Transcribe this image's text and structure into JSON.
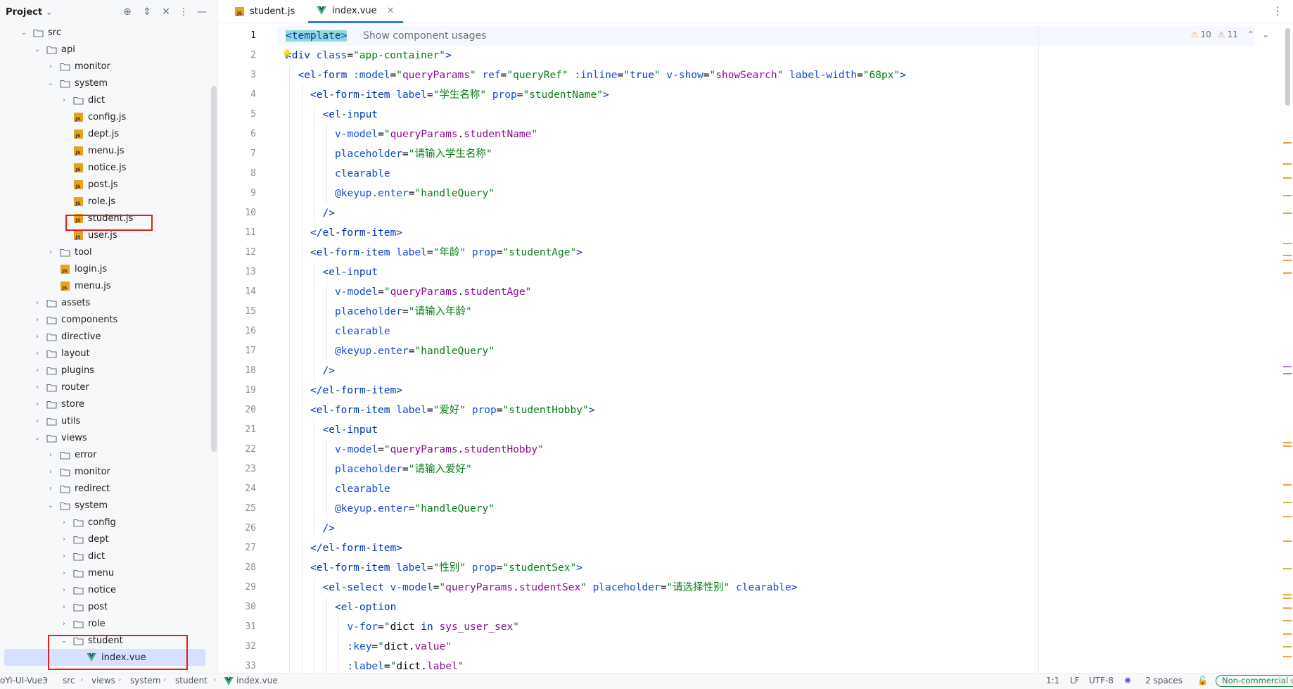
{
  "project_panel": {
    "title": "Project",
    "tree": [
      {
        "label": "src",
        "type": "folder",
        "depth": 0,
        "expanded": true
      },
      {
        "label": "api",
        "type": "folder",
        "depth": 1,
        "expanded": true
      },
      {
        "label": "monitor",
        "type": "folder",
        "depth": 2,
        "expanded": false
      },
      {
        "label": "system",
        "type": "folder",
        "depth": 2,
        "expanded": true
      },
      {
        "label": "dict",
        "type": "folder",
        "depth": 3,
        "expanded": false
      },
      {
        "label": "config.js",
        "type": "js",
        "depth": 3
      },
      {
        "label": "dept.js",
        "type": "js",
        "depth": 3
      },
      {
        "label": "menu.js",
        "type": "js",
        "depth": 3
      },
      {
        "label": "notice.js",
        "type": "js",
        "depth": 3
      },
      {
        "label": "post.js",
        "type": "js",
        "depth": 3
      },
      {
        "label": "role.js",
        "type": "js",
        "depth": 3
      },
      {
        "label": "student.js",
        "type": "js",
        "depth": 3
      },
      {
        "label": "user.js",
        "type": "js",
        "depth": 3
      },
      {
        "label": "tool",
        "type": "folder",
        "depth": 2,
        "expanded": false
      },
      {
        "label": "login.js",
        "type": "js",
        "depth": 2
      },
      {
        "label": "menu.js",
        "type": "js",
        "depth": 2
      },
      {
        "label": "assets",
        "type": "folder",
        "depth": 1,
        "expanded": false
      },
      {
        "label": "components",
        "type": "folder",
        "depth": 1,
        "expanded": false
      },
      {
        "label": "directive",
        "type": "folder",
        "depth": 1,
        "expanded": false
      },
      {
        "label": "layout",
        "type": "folder",
        "depth": 1,
        "expanded": false
      },
      {
        "label": "plugins",
        "type": "folder",
        "depth": 1,
        "expanded": false
      },
      {
        "label": "router",
        "type": "folder",
        "depth": 1,
        "expanded": false
      },
      {
        "label": "store",
        "type": "folder",
        "depth": 1,
        "expanded": false
      },
      {
        "label": "utils",
        "type": "folder",
        "depth": 1,
        "expanded": false
      },
      {
        "label": "views",
        "type": "folder",
        "depth": 1,
        "expanded": true
      },
      {
        "label": "error",
        "type": "folder",
        "depth": 2,
        "expanded": false
      },
      {
        "label": "monitor",
        "type": "folder",
        "depth": 2,
        "expanded": false
      },
      {
        "label": "redirect",
        "type": "folder",
        "depth": 2,
        "expanded": false
      },
      {
        "label": "system",
        "type": "folder",
        "depth": 2,
        "expanded": true
      },
      {
        "label": "config",
        "type": "folder",
        "depth": 3,
        "expanded": false
      },
      {
        "label": "dept",
        "type": "folder",
        "depth": 3,
        "expanded": false
      },
      {
        "label": "dict",
        "type": "folder",
        "depth": 3,
        "expanded": false
      },
      {
        "label": "menu",
        "type": "folder",
        "depth": 3,
        "expanded": false
      },
      {
        "label": "notice",
        "type": "folder",
        "depth": 3,
        "expanded": false
      },
      {
        "label": "post",
        "type": "folder",
        "depth": 3,
        "expanded": false
      },
      {
        "label": "role",
        "type": "folder",
        "depth": 3,
        "expanded": false
      },
      {
        "label": "student",
        "type": "folder",
        "depth": 3,
        "expanded": true
      },
      {
        "label": "index.vue",
        "type": "vue",
        "depth": 4,
        "selected": true
      }
    ]
  },
  "tabs": [
    {
      "label": "student.js",
      "type": "js",
      "active": false
    },
    {
      "label": "index.vue",
      "type": "vue",
      "active": true
    }
  ],
  "editor": {
    "inlay_hint": "Show component usages",
    "current_line": 1,
    "inspections": {
      "warnings": "10",
      "weak_warnings": "11"
    },
    "lines": [
      {
        "n": "1",
        "indent": 0,
        "tokens": [
          [
            "hl",
            "<template>"
          ]
        ]
      },
      {
        "n": "2",
        "indent": 0,
        "tokens": [
          [
            "tag",
            "<div "
          ],
          [
            "attr",
            "class"
          ],
          [
            "plain",
            "="
          ],
          [
            "str",
            "\"app-container\""
          ],
          [
            "tag",
            ">"
          ]
        ]
      },
      {
        "n": "3",
        "indent": 1,
        "tokens": [
          [
            "tag",
            "<el-form "
          ],
          [
            "attr",
            ":model"
          ],
          [
            "plain",
            "="
          ],
          [
            "str",
            "\""
          ],
          [
            "bound",
            "queryParams"
          ],
          [
            "str",
            "\""
          ],
          [
            "plain",
            " "
          ],
          [
            "attr",
            "ref"
          ],
          [
            "plain",
            "="
          ],
          [
            "str",
            "\"queryRef\""
          ],
          [
            "plain",
            " "
          ],
          [
            "attr",
            ":inline"
          ],
          [
            "plain",
            "="
          ],
          [
            "str",
            "\""
          ],
          [
            "tag",
            "true"
          ],
          [
            "str",
            "\""
          ],
          [
            "plain",
            " "
          ],
          [
            "attr",
            "v-show"
          ],
          [
            "plain",
            "="
          ],
          [
            "str",
            "\""
          ],
          [
            "bound",
            "showSearch"
          ],
          [
            "str",
            "\""
          ],
          [
            "plain",
            " "
          ],
          [
            "attr",
            "label-width"
          ],
          [
            "plain",
            "="
          ],
          [
            "str",
            "\"68px\""
          ],
          [
            "tag",
            ">"
          ]
        ]
      },
      {
        "n": "4",
        "indent": 2,
        "tokens": [
          [
            "tag",
            "<el-form-item "
          ],
          [
            "attr",
            "label"
          ],
          [
            "plain",
            "="
          ],
          [
            "str",
            "\"学生名称\""
          ],
          [
            "plain",
            " "
          ],
          [
            "attr",
            "prop"
          ],
          [
            "plain",
            "="
          ],
          [
            "str",
            "\"studentName\""
          ],
          [
            "tag",
            ">"
          ]
        ]
      },
      {
        "n": "5",
        "indent": 3,
        "tokens": [
          [
            "tag",
            "<el-input"
          ]
        ]
      },
      {
        "n": "6",
        "indent": 4,
        "tokens": [
          [
            "attr",
            "v-model"
          ],
          [
            "plain",
            "="
          ],
          [
            "str",
            "\""
          ],
          [
            "bound",
            "queryParams"
          ],
          [
            "plain",
            "."
          ],
          [
            "bound",
            "studentName"
          ],
          [
            "str",
            "\""
          ]
        ]
      },
      {
        "n": "7",
        "indent": 4,
        "tokens": [
          [
            "attr",
            "placeholder"
          ],
          [
            "plain",
            "="
          ],
          [
            "str",
            "\"请输入学生名称\""
          ]
        ]
      },
      {
        "n": "8",
        "indent": 4,
        "tokens": [
          [
            "attr",
            "clearable"
          ]
        ]
      },
      {
        "n": "9",
        "indent": 4,
        "tokens": [
          [
            "attr",
            "@keyup.enter"
          ],
          [
            "plain",
            "="
          ],
          [
            "str",
            "\"handleQuery\""
          ]
        ]
      },
      {
        "n": "10",
        "indent": 3,
        "tokens": [
          [
            "tag",
            "/>"
          ]
        ]
      },
      {
        "n": "11",
        "indent": 2,
        "tokens": [
          [
            "tag",
            "</el-form-item>"
          ]
        ]
      },
      {
        "n": "12",
        "indent": 2,
        "tokens": [
          [
            "tag",
            "<el-form-item "
          ],
          [
            "attr",
            "label"
          ],
          [
            "plain",
            "="
          ],
          [
            "str",
            "\"年龄\""
          ],
          [
            "plain",
            " "
          ],
          [
            "attr",
            "prop"
          ],
          [
            "plain",
            "="
          ],
          [
            "str",
            "\"studentAge\""
          ],
          [
            "tag",
            ">"
          ]
        ]
      },
      {
        "n": "13",
        "indent": 3,
        "tokens": [
          [
            "tag",
            "<el-input"
          ]
        ]
      },
      {
        "n": "14",
        "indent": 4,
        "tokens": [
          [
            "attr",
            "v-model"
          ],
          [
            "plain",
            "="
          ],
          [
            "str",
            "\""
          ],
          [
            "bound",
            "queryParams"
          ],
          [
            "plain",
            "."
          ],
          [
            "bound",
            "studentAge"
          ],
          [
            "str",
            "\""
          ]
        ]
      },
      {
        "n": "15",
        "indent": 4,
        "tokens": [
          [
            "attr",
            "placeholder"
          ],
          [
            "plain",
            "="
          ],
          [
            "str",
            "\"请输入年龄\""
          ]
        ]
      },
      {
        "n": "16",
        "indent": 4,
        "tokens": [
          [
            "attr",
            "clearable"
          ]
        ]
      },
      {
        "n": "17",
        "indent": 4,
        "tokens": [
          [
            "attr",
            "@keyup.enter"
          ],
          [
            "plain",
            "="
          ],
          [
            "str",
            "\"handleQuery\""
          ]
        ]
      },
      {
        "n": "18",
        "indent": 3,
        "tokens": [
          [
            "tag",
            "/>"
          ]
        ]
      },
      {
        "n": "19",
        "indent": 2,
        "tokens": [
          [
            "tag",
            "</el-form-item>"
          ]
        ]
      },
      {
        "n": "20",
        "indent": 2,
        "tokens": [
          [
            "tag",
            "<el-form-item "
          ],
          [
            "attr",
            "label"
          ],
          [
            "plain",
            "="
          ],
          [
            "str",
            "\"爱好\""
          ],
          [
            "plain",
            " "
          ],
          [
            "attr",
            "prop"
          ],
          [
            "plain",
            "="
          ],
          [
            "str",
            "\"studentHobby\""
          ],
          [
            "tag",
            ">"
          ]
        ]
      },
      {
        "n": "21",
        "indent": 3,
        "tokens": [
          [
            "tag",
            "<el-input"
          ]
        ]
      },
      {
        "n": "22",
        "indent": 4,
        "tokens": [
          [
            "attr",
            "v-model"
          ],
          [
            "plain",
            "="
          ],
          [
            "str",
            "\""
          ],
          [
            "bound",
            "queryParams"
          ],
          [
            "plain",
            "."
          ],
          [
            "bound",
            "studentHobby"
          ],
          [
            "str",
            "\""
          ]
        ]
      },
      {
        "n": "23",
        "indent": 4,
        "tokens": [
          [
            "attr",
            "placeholder"
          ],
          [
            "plain",
            "="
          ],
          [
            "str",
            "\"请输入爱好\""
          ]
        ]
      },
      {
        "n": "24",
        "indent": 4,
        "tokens": [
          [
            "attr",
            "clearable"
          ]
        ]
      },
      {
        "n": "25",
        "indent": 4,
        "tokens": [
          [
            "attr",
            "@keyup.enter"
          ],
          [
            "plain",
            "="
          ],
          [
            "str",
            "\"handleQuery\""
          ]
        ]
      },
      {
        "n": "26",
        "indent": 3,
        "tokens": [
          [
            "tag",
            "/>"
          ]
        ]
      },
      {
        "n": "27",
        "indent": 2,
        "tokens": [
          [
            "tag",
            "</el-form-item>"
          ]
        ]
      },
      {
        "n": "28",
        "indent": 2,
        "tokens": [
          [
            "tag",
            "<el-form-item "
          ],
          [
            "attr",
            "label"
          ],
          [
            "plain",
            "="
          ],
          [
            "str",
            "\"性别\""
          ],
          [
            "plain",
            " "
          ],
          [
            "attr",
            "prop"
          ],
          [
            "plain",
            "="
          ],
          [
            "str",
            "\"studentSex\""
          ],
          [
            "tag",
            ">"
          ]
        ]
      },
      {
        "n": "29",
        "indent": 3,
        "tokens": [
          [
            "tag",
            "<el-select "
          ],
          [
            "attr",
            "v-model"
          ],
          [
            "plain",
            "="
          ],
          [
            "str",
            "\""
          ],
          [
            "bound",
            "queryParams"
          ],
          [
            "plain",
            "."
          ],
          [
            "bound",
            "studentSex"
          ],
          [
            "str",
            "\""
          ],
          [
            "plain",
            " "
          ],
          [
            "attr",
            "placeholder"
          ],
          [
            "plain",
            "="
          ],
          [
            "str",
            "\"请选择性别\""
          ],
          [
            "plain",
            " "
          ],
          [
            "attr",
            "clearable"
          ],
          [
            "tag",
            ">"
          ]
        ]
      },
      {
        "n": "30",
        "indent": 4,
        "tokens": [
          [
            "tag",
            "<el-option"
          ]
        ]
      },
      {
        "n": "31",
        "indent": 5,
        "tokens": [
          [
            "attr",
            "v-for"
          ],
          [
            "plain",
            "="
          ],
          [
            "str",
            "\""
          ],
          [
            "plain",
            "dict "
          ],
          [
            "tag",
            "in"
          ],
          [
            "plain",
            " "
          ],
          [
            "bound",
            "sys_user_sex"
          ],
          [
            "str",
            "\""
          ]
        ]
      },
      {
        "n": "32",
        "indent": 5,
        "tokens": [
          [
            "attr",
            ":key"
          ],
          [
            "plain",
            "="
          ],
          [
            "str",
            "\""
          ],
          [
            "plain",
            "dict."
          ],
          [
            "bound",
            "value"
          ],
          [
            "str",
            "\""
          ]
        ]
      },
      {
        "n": "33",
        "indent": 5,
        "tokens": [
          [
            "attr",
            ":label"
          ],
          [
            "plain",
            "="
          ],
          [
            "str",
            "\""
          ],
          [
            "plain",
            "dict."
          ],
          [
            "bound",
            "label"
          ],
          [
            "str",
            "\""
          ]
        ]
      }
    ]
  },
  "status_bar": {
    "breadcrumbs": [
      "oYi-UI-Vue3",
      "src",
      "views",
      "system",
      "student",
      "index.vue"
    ],
    "position": "1:1",
    "line_separator": "LF",
    "encoding": "UTF-8",
    "indent": "2 spaces",
    "license": "Non-commercial us"
  },
  "colors": {
    "accent": "#3574f0",
    "annotation_box": "#e0201f",
    "js_icon": "#e6a21a",
    "vue_icon": "#41b883"
  }
}
